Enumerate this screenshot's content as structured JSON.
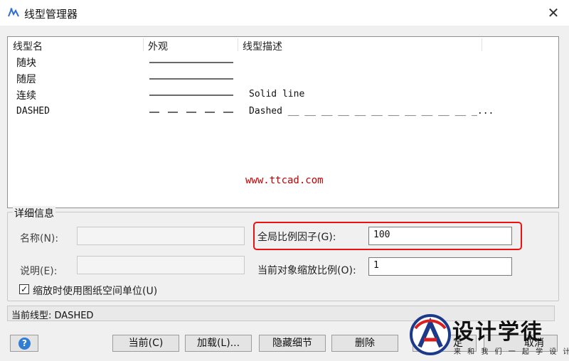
{
  "window": {
    "title": "线型管理器",
    "close_glyph": "✕"
  },
  "list": {
    "headers": [
      "线型名",
      "外观",
      "线型描述"
    ],
    "rows": [
      {
        "name": "随块",
        "appearance": "solid",
        "description": ""
      },
      {
        "name": "随层",
        "appearance": "solid",
        "description": ""
      },
      {
        "name": "连续",
        "appearance": "solid",
        "description": "Solid line"
      },
      {
        "name": "DASHED",
        "appearance": "dashed",
        "description": "Dashed __ __ __ __ __ __ __ __ __ __ __ _..."
      }
    ]
  },
  "watermark": "www.ttcad.com",
  "details": {
    "group_label": "详细信息",
    "name_label": "名称(N):",
    "desc_label": "说明(E):",
    "name_value": "",
    "desc_value": "",
    "global_scale_label": "全局比例因子(G):",
    "global_scale_value": "100",
    "current_scale_label": "当前对象缩放比例(O):",
    "current_scale_value": "1",
    "paper_space_checkbox": {
      "label": "缩放时使用图纸空间单位(U)",
      "checked": true
    }
  },
  "status": {
    "current_linetype": "当前线型: DASHED"
  },
  "buttons": {
    "help_glyph": "?",
    "current": "当前(C)",
    "load": "加载(L)...",
    "hide_details": "隐藏细节",
    "delete": "删除",
    "ok_partial": "定",
    "cancel_partial": "取消"
  },
  "logo": {
    "name": "设计学徒",
    "slogan": "来 和 我 们 一 起 学 设 计"
  },
  "colors": {
    "highlight_border": "#e11111",
    "watermark": "#c00000",
    "help_icon": "#2f7dd4"
  }
}
